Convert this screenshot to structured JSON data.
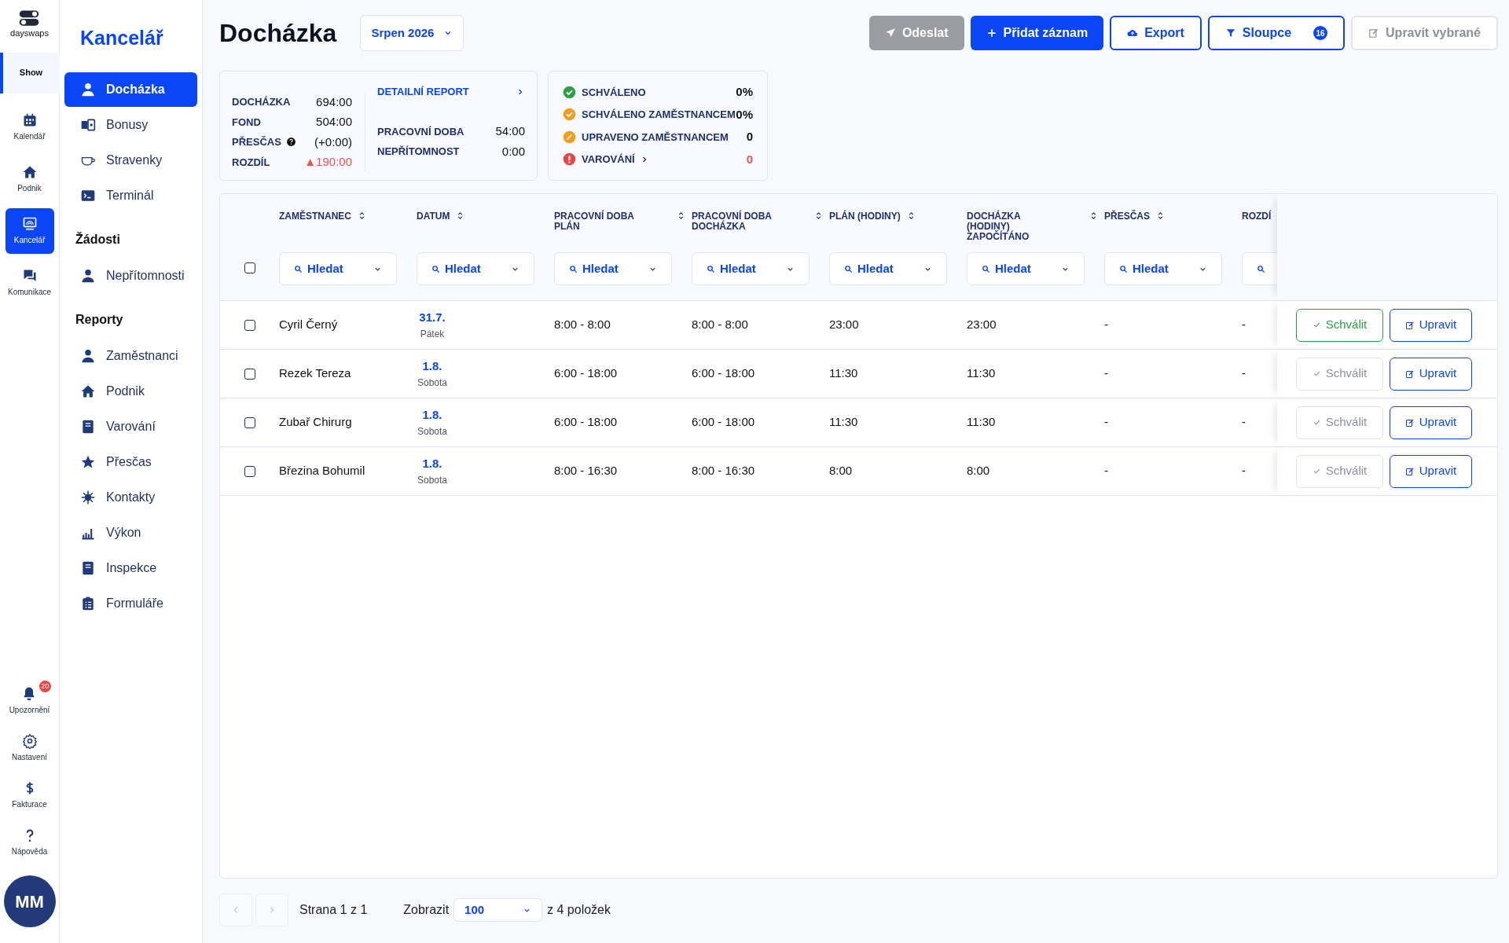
{
  "rail": {
    "logo": "dayswaps",
    "workspace": "Show",
    "top": [
      {
        "label": "Kalendář",
        "selected": false,
        "kind": "calendar"
      },
      {
        "label": "Podnik",
        "selected": false,
        "kind": "home"
      },
      {
        "label": "Kancelář",
        "selected": true,
        "kind": "office"
      },
      {
        "label": "Komunikace",
        "selected": false,
        "kind": "chat"
      }
    ],
    "bottom": [
      {
        "label": "Upozornění",
        "kind": "bell",
        "badge": "20"
      },
      {
        "label": "Nastavení",
        "kind": "gear"
      },
      {
        "label": "Fakturace",
        "kind": "dollar"
      },
      {
        "label": "Nápověda",
        "kind": "help"
      }
    ],
    "avatar": "MM"
  },
  "sidebar": {
    "title": "Kancelář",
    "sections": [
      {
        "items": [
          {
            "label": "Docházka",
            "selected": true
          },
          {
            "label": "Bonusy",
            "selected": false
          },
          {
            "label": "Stravenky",
            "selected": false
          },
          {
            "label": "Terminál",
            "selected": false
          }
        ]
      },
      {
        "heading": "Žádosti",
        "items": [
          {
            "label": "Nepřítomnosti",
            "selected": false
          }
        ]
      },
      {
        "heading": "Reporty",
        "items": [
          {
            "label": "Zaměstnanci",
            "selected": false
          },
          {
            "label": "Podnik",
            "selected": false
          },
          {
            "label": "Varování",
            "selected": false
          },
          {
            "label": "Přesčas",
            "selected": false
          },
          {
            "label": "Kontakty",
            "selected": false
          },
          {
            "label": "Výkon",
            "selected": false
          },
          {
            "label": "Inspekce",
            "selected": false
          },
          {
            "label": "Formuláře",
            "selected": false
          }
        ]
      }
    ]
  },
  "header": {
    "title": "Docházka",
    "period": "Srpen 2026",
    "buttons": [
      {
        "label": "Odeslat",
        "kind": "send",
        "disabled": true
      },
      {
        "label": "Přidat záznam",
        "kind": "add",
        "disabled": false
      },
      {
        "label": "Export",
        "kind": "export",
        "disabled": false
      },
      {
        "label": "Sloupce",
        "kind": "columns",
        "disabled": false,
        "badge": "16"
      },
      {
        "label": "Upravit vybrané",
        "kind": "edit",
        "disabled": true
      }
    ]
  },
  "summary": {
    "left": [
      {
        "label": "DOCHÁZKA",
        "value": "694:00",
        "help": false,
        "negative": false
      },
      {
        "label": "FOND",
        "value": "504:00",
        "help": false,
        "negative": false
      },
      {
        "label": "PŘESČAS",
        "value": "(+0:00)",
        "help": true,
        "negative": false
      },
      {
        "label": "ROZDÍL",
        "value": "▲190:00",
        "help": false,
        "negative": true
      }
    ],
    "link": "DETAILNÍ REPORT",
    "right": [
      {
        "label": "PRACOVNÍ DOBA",
        "value": "54:00"
      },
      {
        "label": "NEPŘÍTOMNOST",
        "value": "0:00"
      }
    ]
  },
  "statuses": [
    {
      "label": "SCHVÁLENO",
      "value": "0%",
      "kind": "approved",
      "link": false,
      "negative": false
    },
    {
      "label": "SCHVÁLENO ZAMĚSTNANCEM",
      "value": "0%",
      "kind": "employee",
      "link": false,
      "negative": false
    },
    {
      "label": "UPRAVENO ZAMĚSTNANCEM",
      "value": "0",
      "kind": "edited",
      "link": false,
      "negative": false
    },
    {
      "label": "VAROVÁNÍ",
      "value": "0",
      "kind": "warning",
      "link": true,
      "negative": true
    }
  ],
  "table": {
    "all_checked": false,
    "columns": [
      {
        "label": "ZAMĚSTNANEC",
        "filter": "Hledat"
      },
      {
        "label": "DATUM",
        "filter": "Hledat"
      },
      {
        "label": "PRACOVNÍ DOBA PLÁN",
        "filter": "Hledat"
      },
      {
        "label": "PRACOVNÍ DOBA DOCHÁZKA",
        "filter": "Hledat"
      },
      {
        "label": "PLÁN (HODINY)",
        "filter": "Hledat"
      },
      {
        "label": "DOCHÁZKA (HODINY) ZAPOČÍTÁNO",
        "filter": "Hledat"
      },
      {
        "label": "PŘESČAS",
        "filter": "Hledat"
      },
      {
        "label": "ROZDÍ"
      }
    ],
    "rows": [
      {
        "checked": false,
        "employee": "Cyril Černý",
        "date": "31.7.",
        "day": "Pátek",
        "plan": "8:00 - 8:00",
        "attendance": "8:00 - 8:00",
        "plan_hours": "23:00",
        "counted": "23:00",
        "overtime": "-",
        "difference": "-",
        "approve": {
          "label": "Schválit",
          "disabled": false
        },
        "edit": "Upravit"
      },
      {
        "checked": false,
        "employee": "Rezek Tereza",
        "date": "1.8.",
        "day": "Sobota",
        "plan": "6:00 - 18:00",
        "attendance": "6:00 - 18:00",
        "plan_hours": "11:30",
        "counted": "11:30",
        "overtime": "-",
        "difference": "-",
        "approve": {
          "label": "Schválit",
          "disabled": true
        },
        "edit": "Upravit"
      },
      {
        "checked": false,
        "employee": "Zubař Chirurg",
        "date": "1.8.",
        "day": "Sobota",
        "plan": "6:00 - 18:00",
        "attendance": "6:00 - 18:00",
        "plan_hours": "11:30",
        "counted": "11:30",
        "overtime": "-",
        "difference": "-",
        "approve": {
          "label": "Schválit",
          "disabled": true
        },
        "edit": "Upravit"
      },
      {
        "checked": false,
        "employee": "Březina Bohumil",
        "date": "1.8.",
        "day": "Sobota",
        "plan": "8:00 - 16:30",
        "attendance": "8:00 - 16:30",
        "plan_hours": "8:00",
        "counted": "8:00",
        "overtime": "-",
        "difference": "-",
        "approve": {
          "label": "Schválit",
          "disabled": true
        },
        "edit": "Upravit"
      }
    ]
  },
  "pagination": {
    "page": "Strana 1 z 1",
    "show_label": "Zobrazit",
    "page_size": "100",
    "total": "z 4 položek"
  }
}
